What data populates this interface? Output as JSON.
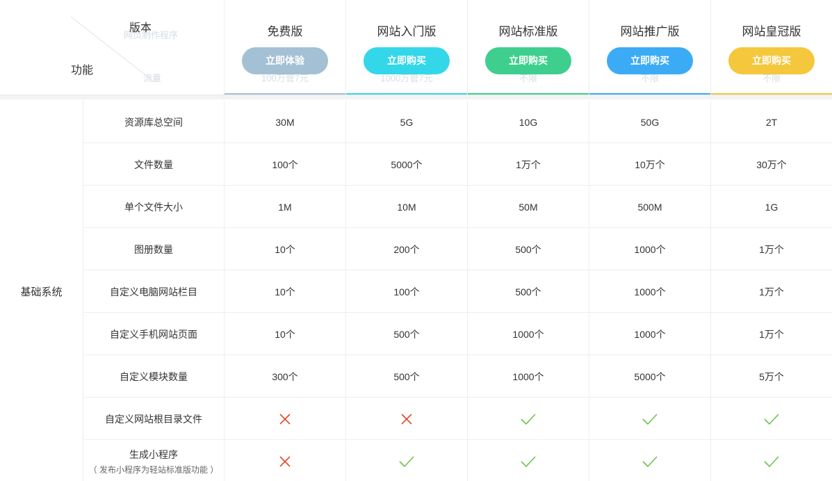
{
  "corner": {
    "top_label": "版本",
    "left_label": "功能",
    "ghost_top": "网页制作程序",
    "ghost_bottom": "流量"
  },
  "plans": [
    {
      "name": "免费版",
      "button": "立即体验",
      "ghost": "100万管7元",
      "color": "#a4c0d4"
    },
    {
      "name": "网站入门版",
      "button": "立即购买",
      "ghost": "1000万管7元",
      "color": "#34d7ea"
    },
    {
      "name": "网站标准版",
      "button": "立即购买",
      "ghost": "不限",
      "color": "#3ecf8e"
    },
    {
      "name": "网站推广版",
      "button": "立即购买",
      "ghost": "不限",
      "color": "#3cabf5"
    },
    {
      "name": "网站皇冠版",
      "button": "立即购买",
      "ghost": "不限",
      "color": "#f4c73d"
    }
  ],
  "group": {
    "label": "基础系统"
  },
  "rows": [
    {
      "feature": "资源库总空间",
      "sub": "",
      "values": [
        "30M",
        "5G",
        "10G",
        "50G",
        "2T"
      ]
    },
    {
      "feature": "文件数量",
      "sub": "",
      "values": [
        "100个",
        "5000个",
        "1万个",
        "10万个",
        "30万个"
      ]
    },
    {
      "feature": "单个文件大小",
      "sub": "",
      "values": [
        "1M",
        "10M",
        "50M",
        "500M",
        "1G"
      ]
    },
    {
      "feature": "图册数量",
      "sub": "",
      "values": [
        "10个",
        "200个",
        "500个",
        "1000个",
        "1万个"
      ]
    },
    {
      "feature": "自定义电脑网站栏目",
      "sub": "",
      "values": [
        "10个",
        "100个",
        "500个",
        "1000个",
        "1万个"
      ]
    },
    {
      "feature": "自定义手机网站页面",
      "sub": "",
      "values": [
        "10个",
        "500个",
        "1000个",
        "1000个",
        "1万个"
      ]
    },
    {
      "feature": "自定义模块数量",
      "sub": "",
      "values": [
        "300个",
        "500个",
        "1000个",
        "5000个",
        "5万个"
      ]
    },
    {
      "feature": "自定义网站根目录文件",
      "sub": "",
      "values": [
        "cross",
        "cross",
        "check",
        "check",
        "check"
      ]
    },
    {
      "feature": "生成小程序",
      "sub": "（ 发布小程序为轻站标准版功能 ）",
      "values": [
        "cross",
        "check",
        "check",
        "check",
        "check"
      ]
    }
  ],
  "icons": {
    "cross": "cross-icon",
    "check": "check-icon",
    "cross_color": "#e04b2c",
    "check_color": "#6cc24a"
  }
}
